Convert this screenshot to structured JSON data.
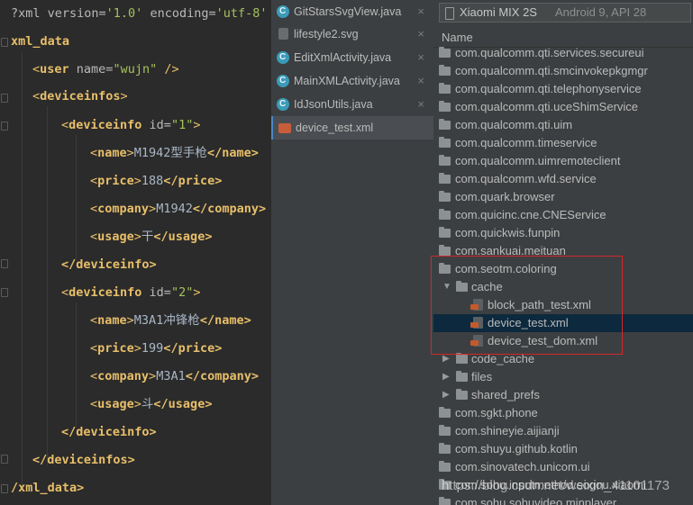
{
  "editor": {
    "lines": [
      {
        "decl": "?xml version=",
        "v1": "'1.0'",
        "mid": " encoding=",
        "v2": "'utf-8'"
      },
      {
        "tag": "xml_data"
      },
      {
        "open": "<",
        "tag": "user",
        "attr": " name=",
        "val": "\"wujn\"",
        "close": " />"
      },
      {
        "open": "<",
        "tag": "deviceinfos",
        "close": ">"
      },
      {
        "open": "<",
        "tag": "deviceinfo",
        "attr": " id=",
        "val": "\"1\"",
        "close": ">"
      },
      {
        "open": "<",
        "tag": "name",
        "text": "M1942型手枪",
        "close_tag": "</name>"
      },
      {
        "open": "<",
        "tag": "price",
        "text": "188",
        "close_tag": "</price>"
      },
      {
        "open": "<",
        "tag": "company",
        "text": "M1942",
        "close_tag": "</company>"
      },
      {
        "open": "<",
        "tag": "usage",
        "text": "干",
        "close_tag": "</usage>"
      },
      {
        "end": "</deviceinfo>"
      },
      {
        "open": "<",
        "tag": "deviceinfo",
        "attr": " id=",
        "val": "\"2\"",
        "close": ">"
      },
      {
        "open": "<",
        "tag": "name",
        "text": "M3A1冲锋枪",
        "close_tag": "</name>"
      },
      {
        "open": "<",
        "tag": "price",
        "text": "199",
        "close_tag": "</price>"
      },
      {
        "open": "<",
        "tag": "company",
        "text": "M3A1",
        "close_tag": "</company>"
      },
      {
        "open": "<",
        "tag": "usage",
        "text": "斗",
        "close_tag": "</usage>"
      },
      {
        "end": "</deviceinfo>"
      },
      {
        "end": "</deviceinfos>"
      },
      {
        "end": "/xml_data>"
      }
    ]
  },
  "tabs": [
    {
      "label": "GitStarsSvgView.java",
      "icon": "java-class-icon",
      "active": false
    },
    {
      "label": "lifestyle2.svg",
      "icon": "svg-file-icon",
      "active": false
    },
    {
      "label": "EditXmlActivity.java",
      "icon": "java-class-icon",
      "active": false
    },
    {
      "label": "MainXMLActivity.java",
      "icon": "java-class-icon",
      "active": false
    },
    {
      "label": "IdJsonUtils.java",
      "icon": "java-class-icon",
      "active": false
    },
    {
      "label": "device_test.xml",
      "icon": "xml-file-icon",
      "active": true
    }
  ],
  "tab_close_glyph": "×",
  "explorer": {
    "device_name": "Xiaomi MIX 2S",
    "device_sub": "Android 9, API 28",
    "column_header": "Name",
    "rows": [
      {
        "label": "com.qualcomm.qti.services.secureui",
        "type": "folder",
        "indent": 0
      },
      {
        "label": "com.qualcomm.qti.smcinvokepkgmgr",
        "type": "folder",
        "indent": 0
      },
      {
        "label": "com.qualcomm.qti.telephonyservice",
        "type": "folder",
        "indent": 0
      },
      {
        "label": "com.qualcomm.qti.uceShimService",
        "type": "folder",
        "indent": 0
      },
      {
        "label": "com.qualcomm.qti.uim",
        "type": "folder",
        "indent": 0
      },
      {
        "label": "com.qualcomm.timeservice",
        "type": "folder",
        "indent": 0
      },
      {
        "label": "com.qualcomm.uimremoteclient",
        "type": "folder",
        "indent": 0
      },
      {
        "label": "com.qualcomm.wfd.service",
        "type": "folder",
        "indent": 0
      },
      {
        "label": "com.quark.browser",
        "type": "folder",
        "indent": 0
      },
      {
        "label": "com.quicinc.cne.CNEService",
        "type": "folder",
        "indent": 0
      },
      {
        "label": "com.quickwis.funpin",
        "type": "folder",
        "indent": 0
      },
      {
        "label": "com.sankuai.meituan",
        "type": "folder",
        "indent": 0
      },
      {
        "label": "com.seotm.coloring",
        "type": "folder",
        "indent": 0
      },
      {
        "label": "cache",
        "type": "folder-open",
        "indent": 1
      },
      {
        "label": "block_path_test.xml",
        "type": "file",
        "indent": 2
      },
      {
        "label": "device_test.xml",
        "type": "file",
        "indent": 2,
        "selected": true
      },
      {
        "label": "device_test_dom.xml",
        "type": "file",
        "indent": 2
      },
      {
        "label": "code_cache",
        "type": "folder-closed",
        "indent": 1
      },
      {
        "label": "files",
        "type": "folder-closed",
        "indent": 1
      },
      {
        "label": "shared_prefs",
        "type": "folder-closed",
        "indent": 1
      },
      {
        "label": "com.sgkt.phone",
        "type": "folder",
        "indent": 0
      },
      {
        "label": "com.shineyie.aijianji",
        "type": "folder",
        "indent": 0
      },
      {
        "label": "com.shuyu.github.kotlin",
        "type": "folder",
        "indent": 0
      },
      {
        "label": "com.sinovatech.unicom.ui",
        "type": "folder",
        "indent": 0
      },
      {
        "label": "com.sohu.inputmethod.sogou.xiaomi",
        "type": "folder",
        "indent": 0
      },
      {
        "label": "com.sohu.sohuvideo.minplayer",
        "type": "folder",
        "indent": 0
      }
    ]
  },
  "watermark": "https://blog.csdn.net/weixin_41101173",
  "colors": {
    "accent": "#4a88c7",
    "highlight": "#d4262b",
    "selected_row": "#0d293e"
  }
}
